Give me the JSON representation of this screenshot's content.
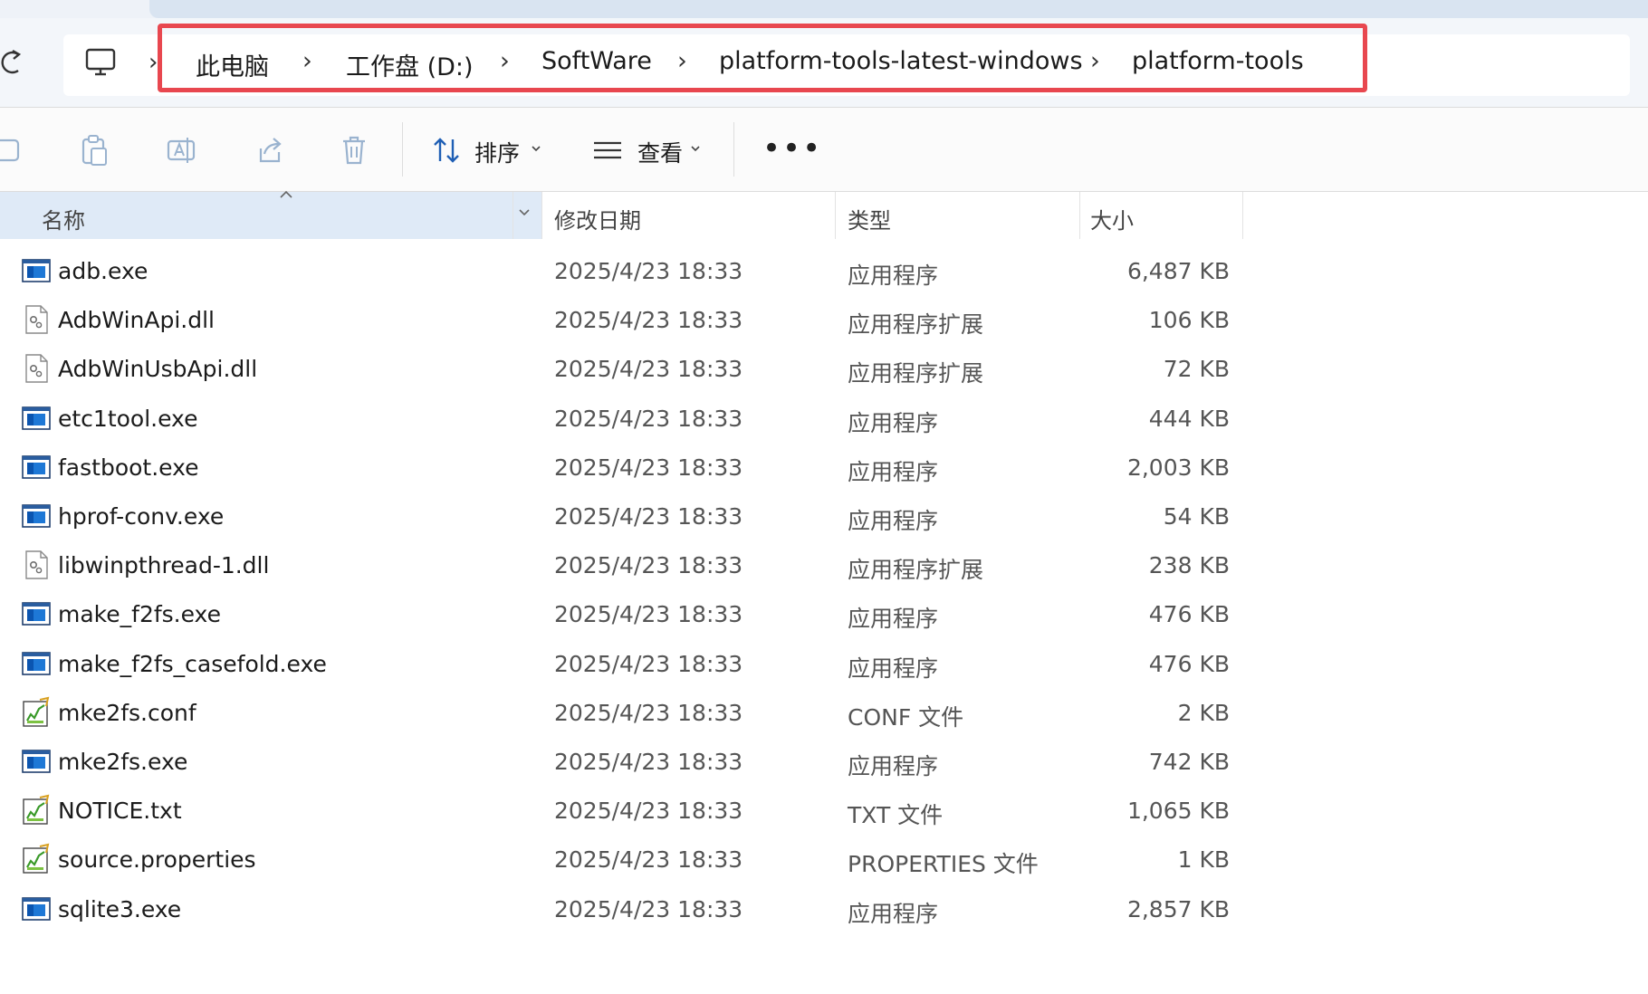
{
  "breadcrumb": {
    "items": [
      "此电脑",
      "工作盘 (D:)",
      "SoftWare",
      "platform-tools-latest-windows",
      "platform-tools"
    ],
    "separator": "›",
    "highlight_color": "#e8474f"
  },
  "toolbar": {
    "sort_label": "排序",
    "view_label": "查看",
    "more_label": "•••"
  },
  "columns": {
    "name": "名称",
    "date": "修改日期",
    "type": "类型",
    "size": "大小"
  },
  "files": [
    {
      "name": "adb.exe",
      "date": "2025/4/23 18:33",
      "type": "应用程序",
      "size": "6,487 KB",
      "icon": "exe"
    },
    {
      "name": "AdbWinApi.dll",
      "date": "2025/4/23 18:33",
      "type": "应用程序扩展",
      "size": "106 KB",
      "icon": "dll"
    },
    {
      "name": "AdbWinUsbApi.dll",
      "date": "2025/4/23 18:33",
      "type": "应用程序扩展",
      "size": "72 KB",
      "icon": "dll"
    },
    {
      "name": "etc1tool.exe",
      "date": "2025/4/23 18:33",
      "type": "应用程序",
      "size": "444 KB",
      "icon": "exe"
    },
    {
      "name": "fastboot.exe",
      "date": "2025/4/23 18:33",
      "type": "应用程序",
      "size": "2,003 KB",
      "icon": "exe"
    },
    {
      "name": "hprof-conv.exe",
      "date": "2025/4/23 18:33",
      "type": "应用程序",
      "size": "54 KB",
      "icon": "exe"
    },
    {
      "name": "libwinpthread-1.dll",
      "date": "2025/4/23 18:33",
      "type": "应用程序扩展",
      "size": "238 KB",
      "icon": "dll"
    },
    {
      "name": "make_f2fs.exe",
      "date": "2025/4/23 18:33",
      "type": "应用程序",
      "size": "476 KB",
      "icon": "exe"
    },
    {
      "name": "make_f2fs_casefold.exe",
      "date": "2025/4/23 18:33",
      "type": "应用程序",
      "size": "476 KB",
      "icon": "exe"
    },
    {
      "name": "mke2fs.conf",
      "date": "2025/4/23 18:33",
      "type": "CONF 文件",
      "size": "2 KB",
      "icon": "text"
    },
    {
      "name": "mke2fs.exe",
      "date": "2025/4/23 18:33",
      "type": "应用程序",
      "size": "742 KB",
      "icon": "exe"
    },
    {
      "name": "NOTICE.txt",
      "date": "2025/4/23 18:33",
      "type": "TXT 文件",
      "size": "1,065 KB",
      "icon": "text"
    },
    {
      "name": "source.properties",
      "date": "2025/4/23 18:33",
      "type": "PROPERTIES 文件",
      "size": "1 KB",
      "icon": "text"
    },
    {
      "name": "sqlite3.exe",
      "date": "2025/4/23 18:33",
      "type": "应用程序",
      "size": "2,857 KB",
      "icon": "exe"
    }
  ]
}
